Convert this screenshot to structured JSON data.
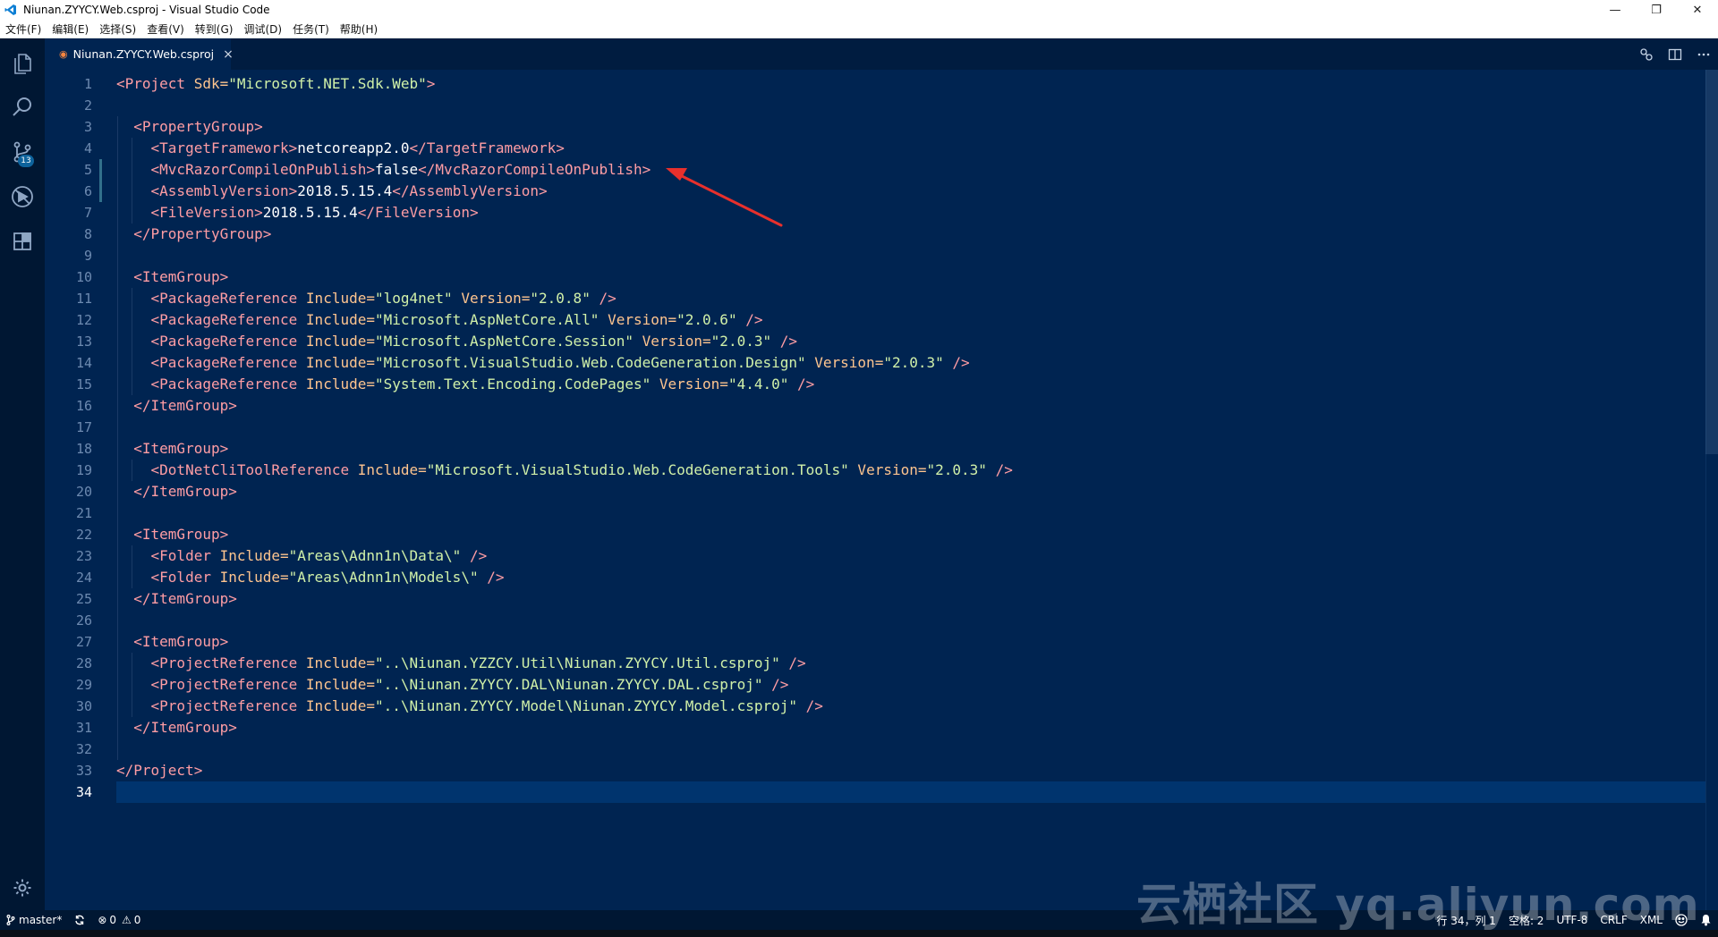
{
  "window": {
    "title": "Niunan.ZYYCY.Web.csproj - Visual Studio Code"
  },
  "menu": [
    "文件(F)",
    "编辑(E)",
    "选择(S)",
    "查看(V)",
    "转到(G)",
    "调试(D)",
    "任务(T)",
    "帮助(H)"
  ],
  "activity_bar": {
    "icons": [
      "files-icon",
      "search-icon",
      "source-control-icon",
      "debug-icon",
      "extensions-icon"
    ],
    "scm_badge": "13",
    "bottom_icon": "gear-icon"
  },
  "tab": {
    "label": "Niunan.ZYYCY.Web.csproj",
    "icon": "rss-file-icon",
    "close": "×"
  },
  "editor": {
    "active_line": 34,
    "modified_lines": [
      5,
      6
    ],
    "lines": [
      [
        [
          "t",
          "<Project "
        ],
        [
          "a",
          "Sdk="
        ],
        [
          "s",
          "\"Microsoft.NET.Sdk.Web\""
        ],
        [
          "t",
          ">"
        ]
      ],
      [],
      [
        [
          "x",
          "  "
        ],
        [
          "t",
          "<PropertyGroup>"
        ]
      ],
      [
        [
          "x",
          "    "
        ],
        [
          "t",
          "<TargetFramework>"
        ],
        [
          "x",
          "netcoreapp2.0"
        ],
        [
          "t",
          "</TargetFramework>"
        ]
      ],
      [
        [
          "x",
          "    "
        ],
        [
          "t",
          "<MvcRazorCompileOnPublish>"
        ],
        [
          "x",
          "false"
        ],
        [
          "t",
          "</MvcRazorCompileOnPublish>"
        ]
      ],
      [
        [
          "x",
          "    "
        ],
        [
          "t",
          "<AssemblyVersion>"
        ],
        [
          "x",
          "2018.5.15.4"
        ],
        [
          "t",
          "</AssemblyVersion>"
        ]
      ],
      [
        [
          "x",
          "    "
        ],
        [
          "t",
          "<FileVersion>"
        ],
        [
          "x",
          "2018.5.15.4"
        ],
        [
          "t",
          "</FileVersion>"
        ]
      ],
      [
        [
          "x",
          "  "
        ],
        [
          "t",
          "</PropertyGroup>"
        ]
      ],
      [],
      [
        [
          "x",
          "  "
        ],
        [
          "t",
          "<ItemGroup>"
        ]
      ],
      [
        [
          "x",
          "    "
        ],
        [
          "t",
          "<PackageReference "
        ],
        [
          "a",
          "Include="
        ],
        [
          "s",
          "\"log4net\""
        ],
        [
          "a",
          " Version="
        ],
        [
          "s",
          "\"2.0.8\""
        ],
        [
          "t",
          " />"
        ]
      ],
      [
        [
          "x",
          "    "
        ],
        [
          "t",
          "<PackageReference "
        ],
        [
          "a",
          "Include="
        ],
        [
          "s",
          "\"Microsoft.AspNetCore.All\""
        ],
        [
          "a",
          " Version="
        ],
        [
          "s",
          "\"2.0.6\""
        ],
        [
          "t",
          " />"
        ]
      ],
      [
        [
          "x",
          "    "
        ],
        [
          "t",
          "<PackageReference "
        ],
        [
          "a",
          "Include="
        ],
        [
          "s",
          "\"Microsoft.AspNetCore.Session\""
        ],
        [
          "a",
          " Version="
        ],
        [
          "s",
          "\"2.0.3\""
        ],
        [
          "t",
          " />"
        ]
      ],
      [
        [
          "x",
          "    "
        ],
        [
          "t",
          "<PackageReference "
        ],
        [
          "a",
          "Include="
        ],
        [
          "s",
          "\"Microsoft.VisualStudio.Web.CodeGeneration.Design\""
        ],
        [
          "a",
          " Version="
        ],
        [
          "s",
          "\"2.0.3\""
        ],
        [
          "t",
          " />"
        ]
      ],
      [
        [
          "x",
          "    "
        ],
        [
          "t",
          "<PackageReference "
        ],
        [
          "a",
          "Include="
        ],
        [
          "s",
          "\"System.Text.Encoding.CodePages\""
        ],
        [
          "a",
          " Version="
        ],
        [
          "s",
          "\"4.4.0\""
        ],
        [
          "t",
          " />"
        ]
      ],
      [
        [
          "x",
          "  "
        ],
        [
          "t",
          "</ItemGroup>"
        ]
      ],
      [],
      [
        [
          "x",
          "  "
        ],
        [
          "t",
          "<ItemGroup>"
        ]
      ],
      [
        [
          "x",
          "    "
        ],
        [
          "t",
          "<DotNetCliToolReference "
        ],
        [
          "a",
          "Include="
        ],
        [
          "s",
          "\"Microsoft.VisualStudio.Web.CodeGeneration.Tools\""
        ],
        [
          "a",
          " Version="
        ],
        [
          "s",
          "\"2.0.3\""
        ],
        [
          "t",
          " />"
        ]
      ],
      [
        [
          "x",
          "  "
        ],
        [
          "t",
          "</ItemGroup>"
        ]
      ],
      [],
      [
        [
          "x",
          "  "
        ],
        [
          "t",
          "<ItemGroup>"
        ]
      ],
      [
        [
          "x",
          "    "
        ],
        [
          "t",
          "<Folder "
        ],
        [
          "a",
          "Include="
        ],
        [
          "s",
          "\"Areas\\Adnn1n\\Data\\\""
        ],
        [
          "t",
          " />"
        ]
      ],
      [
        [
          "x",
          "    "
        ],
        [
          "t",
          "<Folder "
        ],
        [
          "a",
          "Include="
        ],
        [
          "s",
          "\"Areas\\Adnn1n\\Models\\\""
        ],
        [
          "t",
          " />"
        ]
      ],
      [
        [
          "x",
          "  "
        ],
        [
          "t",
          "</ItemGroup>"
        ]
      ],
      [],
      [
        [
          "x",
          "  "
        ],
        [
          "t",
          "<ItemGroup>"
        ]
      ],
      [
        [
          "x",
          "    "
        ],
        [
          "t",
          "<ProjectReference "
        ],
        [
          "a",
          "Include="
        ],
        [
          "s",
          "\"..\\Niunan.YZZCY.Util\\Niunan.ZYYCY.Util.csproj\""
        ],
        [
          "t",
          " />"
        ]
      ],
      [
        [
          "x",
          "    "
        ],
        [
          "t",
          "<ProjectReference "
        ],
        [
          "a",
          "Include="
        ],
        [
          "s",
          "\"..\\Niunan.ZYYCY.DAL\\Niunan.ZYYCY.DAL.csproj\""
        ],
        [
          "t",
          " />"
        ]
      ],
      [
        [
          "x",
          "    "
        ],
        [
          "t",
          "<ProjectReference "
        ],
        [
          "a",
          "Include="
        ],
        [
          "s",
          "\"..\\Niunan.ZYYCY.Model\\Niunan.ZYYCY.Model.csproj\""
        ],
        [
          "t",
          " />"
        ]
      ],
      [
        [
          "x",
          "  "
        ],
        [
          "t",
          "</ItemGroup>"
        ]
      ],
      [],
      [
        [
          "t",
          "</Project>"
        ]
      ],
      []
    ]
  },
  "statusbar": {
    "branch": "master*",
    "errors": "0",
    "warnings": "0",
    "position": "行 34，列 1",
    "indent": "空格: 2",
    "encoding": "UTF-8",
    "eol": "CRLF",
    "language": "XML"
  },
  "watermark": "云栖社区 yq.aliyun.com",
  "colors": {
    "editor_bg": "#002451",
    "tag": "#ff9da4",
    "attr": "#ffc58f",
    "string": "#d1f1a9",
    "text": "#ffffff",
    "arrow": "#e8302c"
  }
}
